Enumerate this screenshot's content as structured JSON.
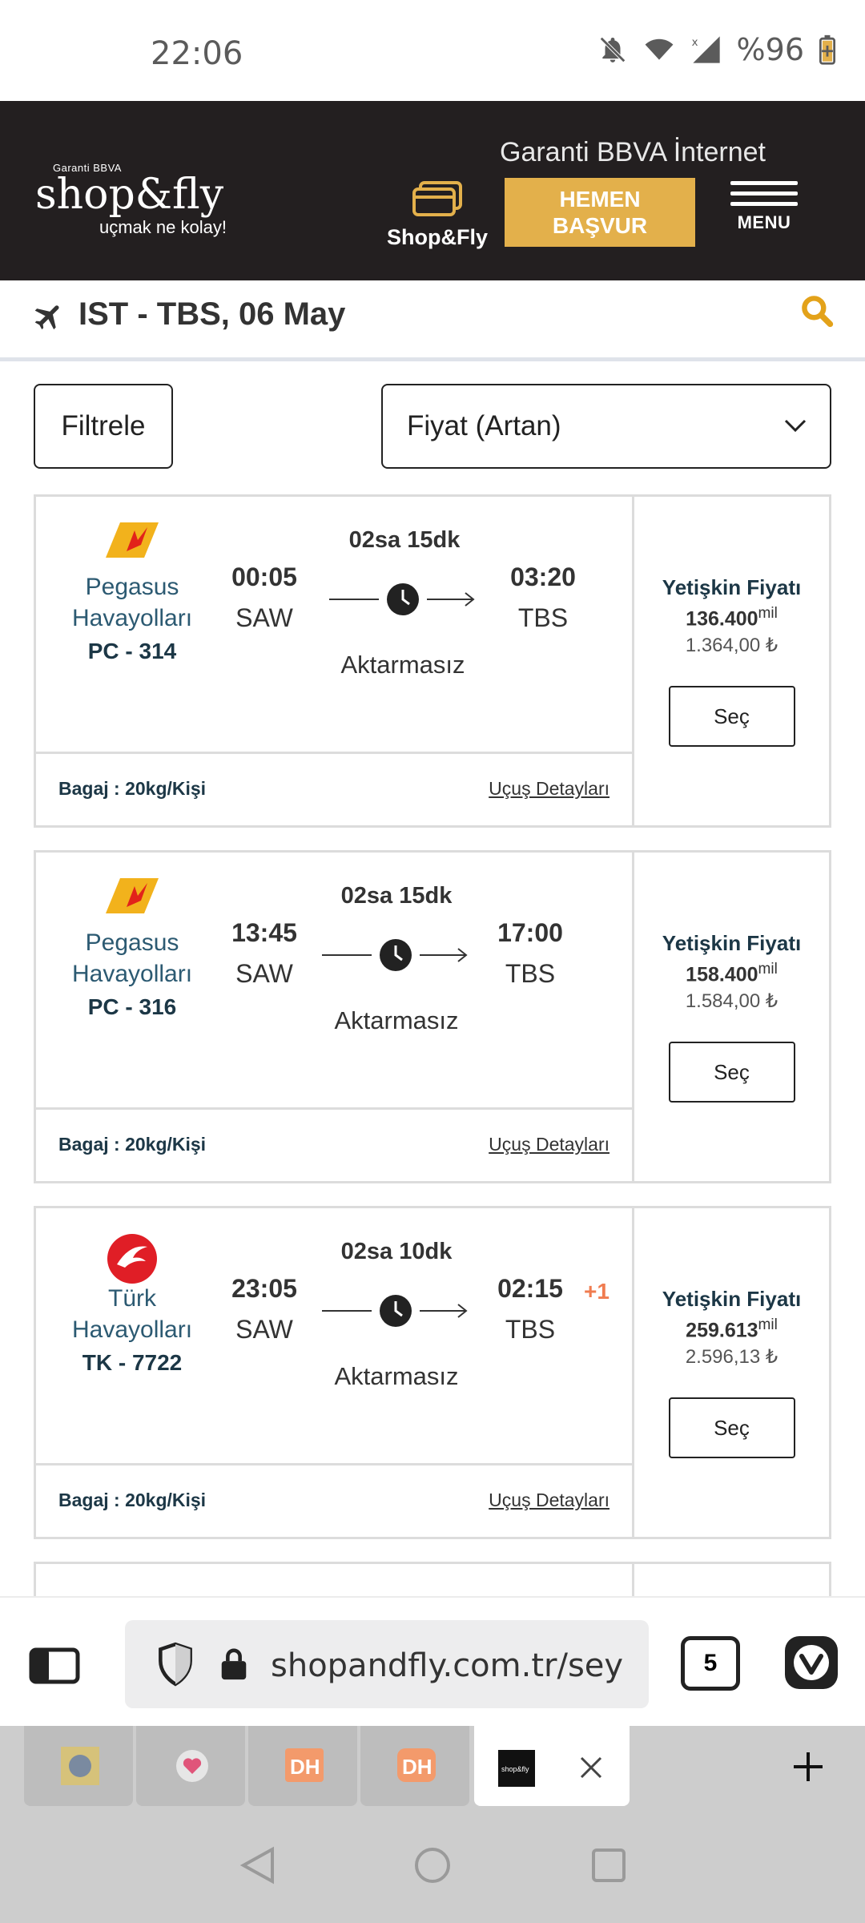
{
  "status_bar": {
    "time": "22:06",
    "battery": "%96"
  },
  "header": {
    "logo_bank": "Garanti BBVA",
    "logo_brand": "shop&fly",
    "logo_tagline": "uçmak ne kolay!",
    "promo_text": "Garanti BBVA İnternet",
    "card_label": "Shop&Fly",
    "apply_line1": "HEMEN",
    "apply_line2": "BAŞVUR",
    "menu_label": "MENU"
  },
  "route": {
    "text": "IST - TBS, 06 May"
  },
  "filters": {
    "filter_label": "Filtrele",
    "sort_value": "Fiyat (Artan)"
  },
  "flights": [
    {
      "airline_line1": "Pegasus",
      "airline_line2": "Havayolları",
      "flight_code": "PC - 314",
      "dep_time": "00:05",
      "dep_code": "SAW",
      "duration": "02sa 15dk",
      "arr_time": "03:20",
      "arr_code": "TBS",
      "transfer": "Aktarmasız",
      "price_label": "Yetişkin Fiyatı",
      "price_mil": "136.400",
      "mil_unit": "mil",
      "price_tl": "1.364,00 ₺",
      "select_label": "Seç",
      "baggage": "Bagaj : 20kg/Kişi",
      "details_link": "Uçuş Detayları"
    },
    {
      "airline_line1": "Pegasus",
      "airline_line2": "Havayolları",
      "flight_code": "PC - 316",
      "dep_time": "13:45",
      "dep_code": "SAW",
      "duration": "02sa 15dk",
      "arr_time": "17:00",
      "arr_code": "TBS",
      "transfer": "Aktarmasız",
      "price_label": "Yetişkin Fiyatı",
      "price_mil": "158.400",
      "mil_unit": "mil",
      "price_tl": "1.584,00 ₺",
      "select_label": "Seç",
      "baggage": "Bagaj : 20kg/Kişi",
      "details_link": "Uçuş Detayları"
    },
    {
      "airline_line1": "Türk",
      "airline_line2": "Havayolları",
      "flight_code": "TK - 7722",
      "dep_time": "23:05",
      "dep_code": "SAW",
      "duration": "02sa 10dk",
      "arr_time": "02:15",
      "arr_code": "TBS",
      "next_day": "+1",
      "transfer": "Aktarmasız",
      "price_label": "Yetişkin Fiyatı",
      "price_mil": "259.613",
      "mil_unit": "mil",
      "price_tl": "2.596,13 ₺",
      "select_label": "Seç",
      "baggage": "Bagaj : 20kg/Kişi",
      "details_link": "Uçuş Detayları"
    }
  ],
  "browser": {
    "url": "shopandfly.com.tr/sey",
    "tab_count": "5"
  },
  "colors": {
    "header_bg": "#231f20",
    "accent": "#e3b04b",
    "navy": "#1c3746",
    "next_day": "#f07c50"
  }
}
